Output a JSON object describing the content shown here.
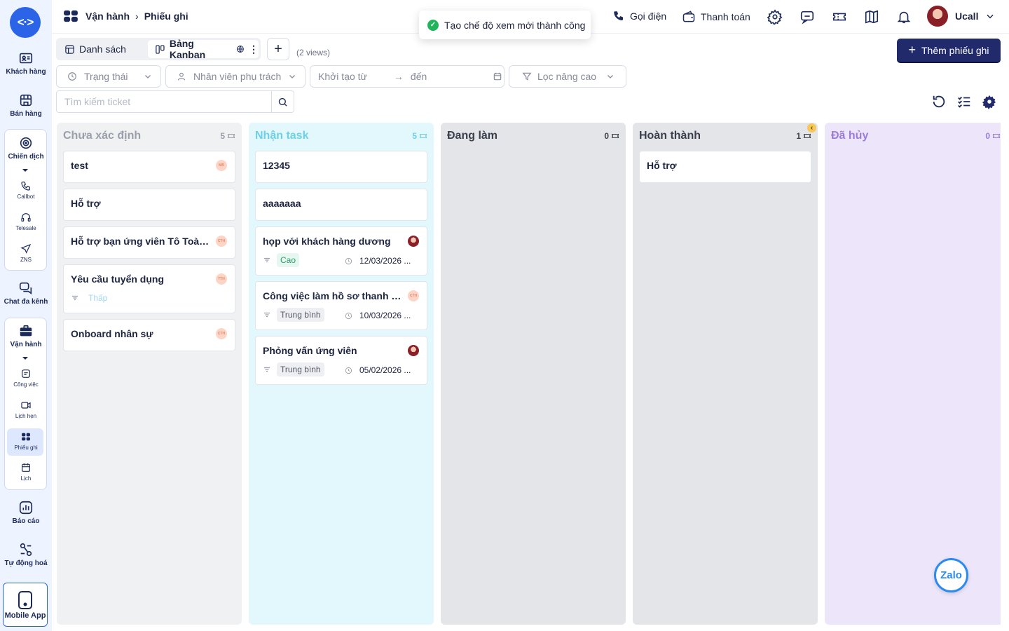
{
  "sidebar": {
    "items": [
      {
        "label": "Khách hàng",
        "icon": "contact-card-icon"
      },
      {
        "label": "Bán hàng",
        "icon": "store-icon"
      },
      {
        "label": "Chiến dịch",
        "icon": "target-icon"
      },
      {
        "label": "Chat đa kênh",
        "icon": "chat-icon"
      },
      {
        "label": "Vận hành",
        "icon": "briefcase-icon"
      },
      {
        "label": "Báo cáo",
        "icon": "report-icon"
      },
      {
        "label": "Tự động hoá",
        "icon": "automation-icon"
      }
    ],
    "campaign_sub": [
      {
        "label": "Callbot",
        "icon": "phone-icon"
      },
      {
        "label": "Telesale",
        "icon": "headset-icon"
      },
      {
        "label": "ZNS",
        "icon": "send-icon"
      }
    ],
    "operation_sub": [
      {
        "label": "Công việc",
        "icon": "task-icon"
      },
      {
        "label": "Lịch hẹn",
        "icon": "appointment-icon"
      },
      {
        "label": "Phiếu ghi",
        "icon": "ticket-icon"
      },
      {
        "label": "Lịch",
        "icon": "calendar-icon"
      }
    ],
    "mobile_app": "Mobile App"
  },
  "header": {
    "breadcrumb": [
      "Vận hành",
      "Phiếu ghi"
    ],
    "call_label": "Gọi điện",
    "payment_label": "Thanh toán",
    "user_name": "Ucall"
  },
  "toast": {
    "message": "Tạo chế độ xem mới thành công"
  },
  "view_tabs": {
    "tabs": [
      {
        "label": "Danh sách"
      },
      {
        "label": "Bảng Kanban"
      }
    ],
    "views_count": "(2 views)"
  },
  "add_ticket_label": "Thêm phiếu ghi",
  "filters": {
    "status": "Trạng thái",
    "assignee": "Nhân viên phụ trách",
    "created_from": "Khởi tạo từ",
    "to": "đến",
    "advanced": "Lọc nâng cao"
  },
  "search": {
    "placeholder": "Tìm kiếm ticket"
  },
  "columns": [
    {
      "title": "Chưa xác định",
      "count": "5",
      "bg": "#f0f1f3",
      "title_color": "#9aa0aa",
      "cards": [
        {
          "title": "test",
          "avatar": "MB"
        },
        {
          "title": "Hỗ trợ"
        },
        {
          "title": "Hỗ trợ bạn ứng viên Tô Toàn p...",
          "avatar": "CTH"
        },
        {
          "title": "Yêu cầu tuyển dụng",
          "avatar": "TTH",
          "priority": "Thấp"
        },
        {
          "title": "Onboard nhân sự",
          "avatar": "CTH"
        }
      ]
    },
    {
      "title": "Nhận task",
      "count": "5",
      "bg": "#e2f8fd",
      "title_color": "#6ed0e6",
      "cards": [
        {
          "title": "12345"
        },
        {
          "title": "aaaaaaa"
        },
        {
          "title": "họp với khách hàng dương",
          "photo": true,
          "priority": "Cao",
          "date": "12/03/2026 ..."
        },
        {
          "title": "Công việc làm hồ sơ thanh toá...",
          "avatar": "CTH",
          "priority": "Trung bình",
          "date": "10/03/2026 ..."
        },
        {
          "title": "Phỏng vấn ứng viên",
          "photo": true,
          "priority": "Trung bình",
          "date": "05/02/2026 ..."
        }
      ]
    },
    {
      "title": "Đang làm",
      "count": "0",
      "bg": "#e4e5e9",
      "title_color": "#3a3f4c",
      "cards": []
    },
    {
      "title": "Hoàn thành",
      "count": "1",
      "bg": "#e4e5e9",
      "title_color": "#3a3f4c",
      "cards": [
        {
          "title": "Hỗ trợ"
        }
      ]
    },
    {
      "title": "Đã hủy",
      "count": "0",
      "bg": "#ede6fb",
      "title_color": "#9b7bdc",
      "cards": []
    }
  ],
  "zalo_label": "Zalo"
}
